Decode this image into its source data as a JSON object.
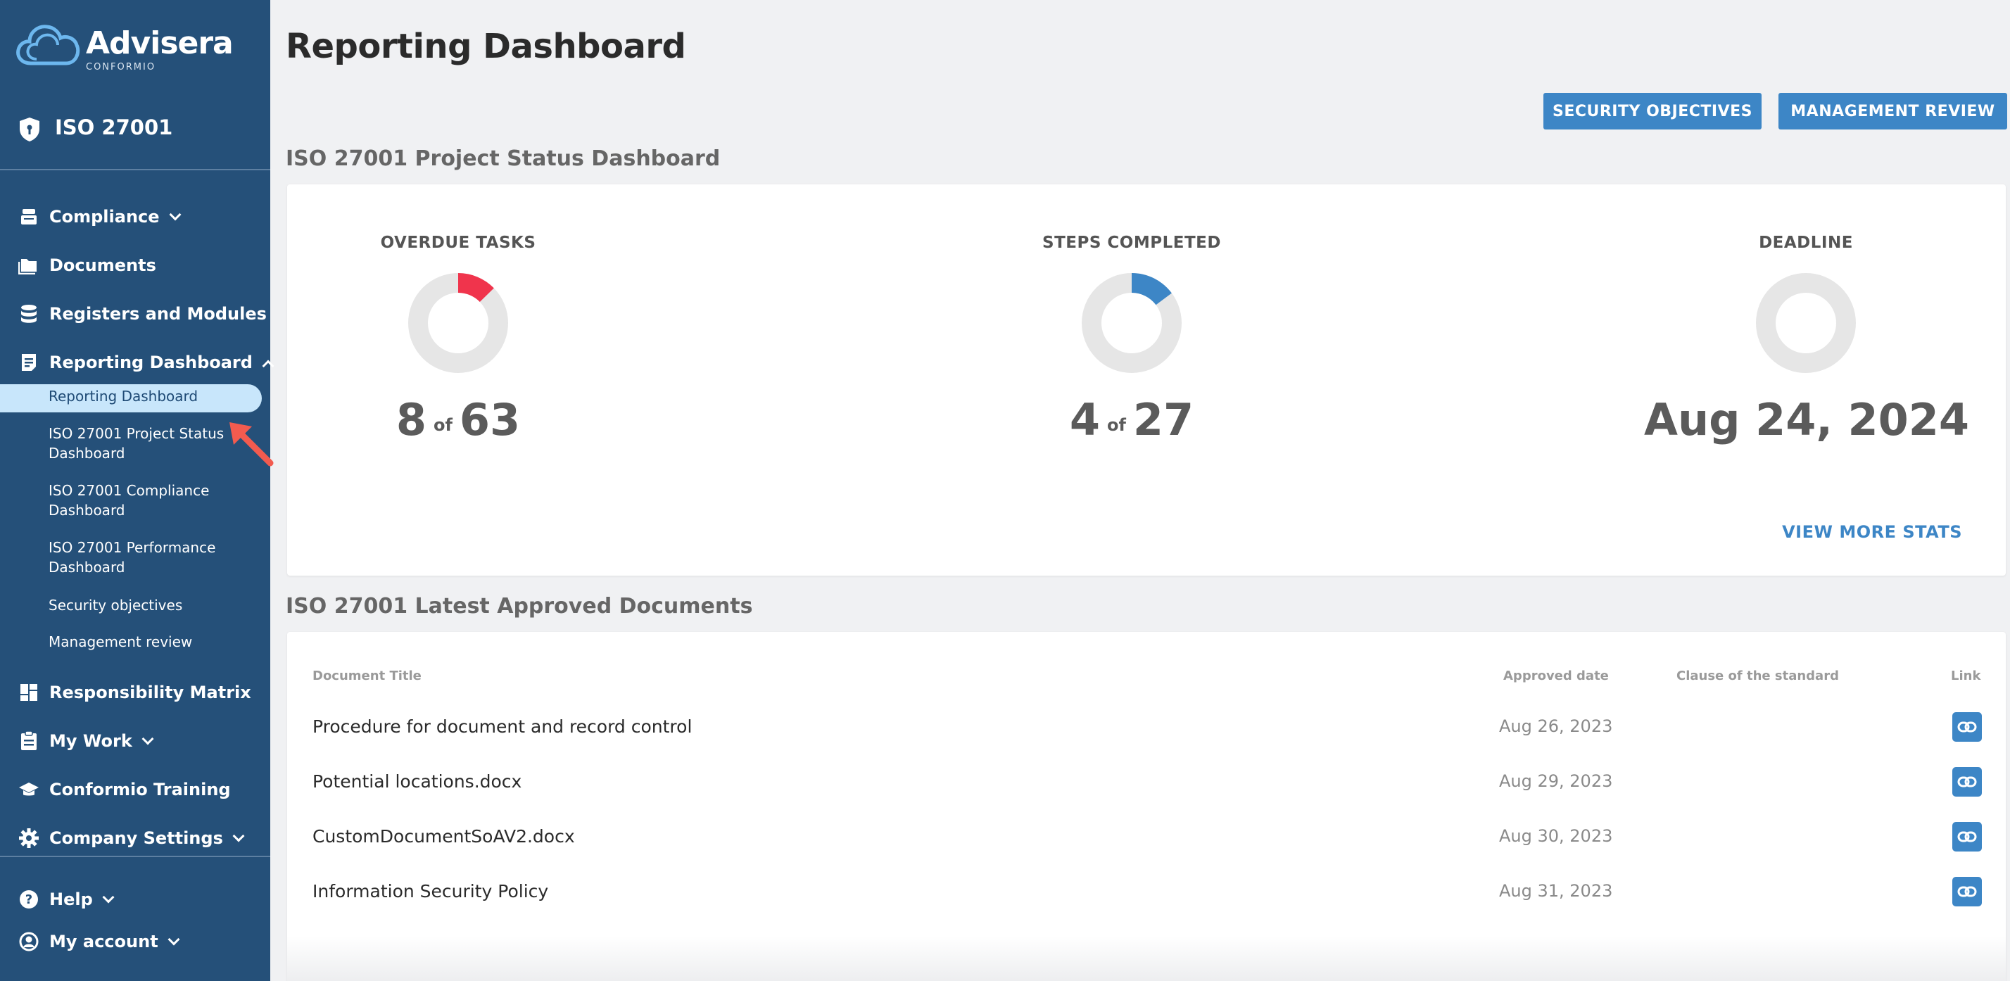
{
  "brand": {
    "name": "Advisera",
    "subtitle": "CONFORMIO",
    "color": "#255079",
    "accent": "#3d86c6"
  },
  "standard": {
    "label": "ISO 27001",
    "icon": "shield-icon"
  },
  "sidebar": {
    "items": [
      {
        "label": "Compliance",
        "icon": "stamp-icon",
        "expandable": true
      },
      {
        "label": "Documents",
        "icon": "folder-icon",
        "expandable": false
      },
      {
        "label": "Registers and Modules",
        "icon": "database-icon",
        "expandable": false
      },
      {
        "label": "Reporting Dashboard",
        "icon": "report-icon",
        "expandable": true,
        "expanded": true
      },
      {
        "label": "Responsibility Matrix",
        "icon": "dashboard-grid-icon",
        "expandable": false
      },
      {
        "label": "My Work",
        "icon": "clipboard-icon",
        "expandable": true
      },
      {
        "label": "Conformio Training",
        "icon": "graduation-cap-icon",
        "expandable": false
      },
      {
        "label": "Company Settings",
        "icon": "gear-icon",
        "expandable": true
      },
      {
        "label": "Help",
        "icon": "help-icon",
        "expandable": true
      },
      {
        "label": "My account",
        "icon": "user-circle-icon",
        "expandable": true
      }
    ],
    "subitems": [
      {
        "label": "Reporting Dashboard",
        "active": true
      },
      {
        "label": "ISO 27001 Project Status Dashboard"
      },
      {
        "label": "ISO 27001 Compliance Dashboard"
      },
      {
        "label": "ISO 27001 Performance Dashboard"
      },
      {
        "label": "Security objectives"
      },
      {
        "label": "Management review"
      }
    ]
  },
  "main": {
    "title": "Reporting Dashboard",
    "buttons": {
      "security_objectives": "SECURITY OBJECTIVES",
      "management_review": "MANAGEMENT REVIEW"
    },
    "status_section": {
      "title": "ISO 27001 Project Status Dashboard",
      "stats": [
        {
          "label": "OVERDUE TASKS",
          "value": "8",
          "of": "of",
          "total": "63",
          "fraction": 0.127,
          "color": "#f0344c"
        },
        {
          "label": "STEPS COMPLETED",
          "value": "4",
          "of": "of",
          "total": "27",
          "fraction": 0.148,
          "color": "#3d86c6"
        },
        {
          "label": "DEADLINE",
          "value": "Aug 24, 2024",
          "fraction": 0,
          "color": "#e6e6e6"
        }
      ],
      "view_more": "VIEW MORE STATS"
    },
    "documents_section": {
      "title": "ISO 27001 Latest Approved Documents",
      "columns": [
        "Document Title",
        "Approved date",
        "Clause of the standard",
        "Link"
      ],
      "rows": [
        {
          "title": "Procedure for document and record control",
          "date": "Aug 26, 2023",
          "clause": ""
        },
        {
          "title": "Potential locations.docx",
          "date": "Aug 29, 2023",
          "clause": ""
        },
        {
          "title": "CustomDocumentSoAV2.docx",
          "date": "Aug 30, 2023",
          "clause": ""
        },
        {
          "title": "Information Security Policy",
          "date": "Aug 31, 2023",
          "clause": ""
        }
      ]
    }
  }
}
